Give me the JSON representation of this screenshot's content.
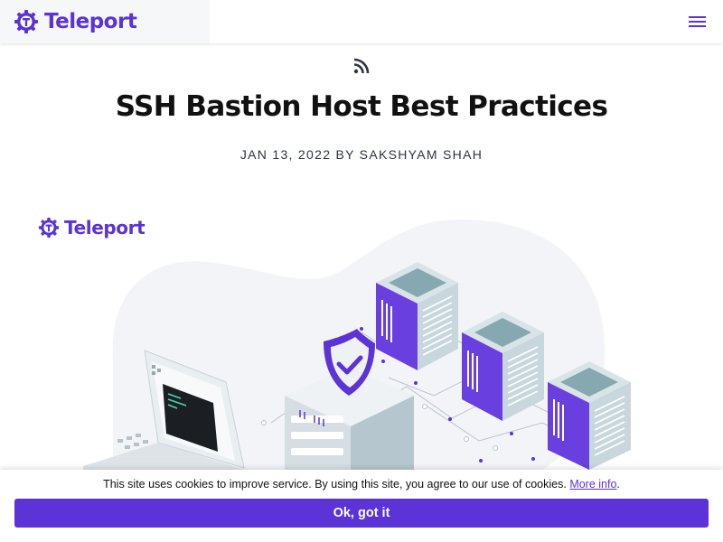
{
  "header": {
    "logo_text": "Teleport",
    "menu_icon": "hamburger-menu-icon"
  },
  "article": {
    "rss_icon": "rss-icon",
    "title": "SSH Bastion Host Best Practices",
    "meta": "JAN 13, 2022 BY SAKSHYAM SHAH"
  },
  "hero": {
    "logo_text": "Teleport",
    "illustration": "bastion-host-servers-illustration"
  },
  "cookie_banner": {
    "text": "This site uses cookies to improve service. By using this site, you agree to our use of cookies.",
    "link_text": "More info",
    "period": ".",
    "button_label": "Ok, got it"
  },
  "colors": {
    "brand": "#5b33d6",
    "server_teal": "#9fc2c9",
    "server_purple": "#6a3fe0",
    "blob": "#f3f4f7"
  }
}
